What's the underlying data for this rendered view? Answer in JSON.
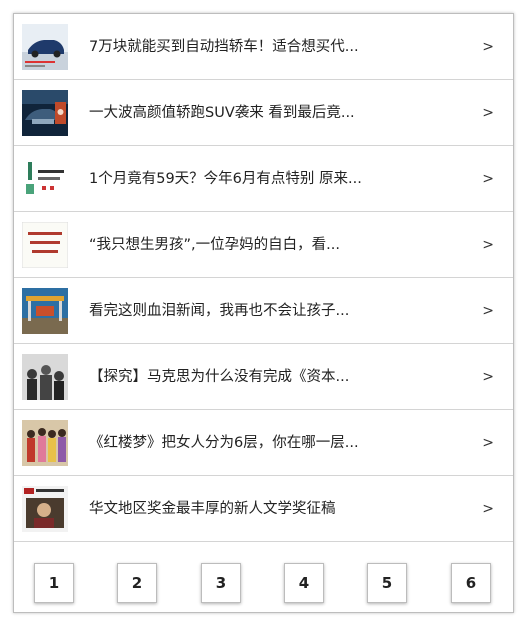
{
  "articles": [
    {
      "title": "7万块就能买到自动挡轿车！适合想买代...",
      "arrow": ">",
      "thumb_icon": "car-photo-icon",
      "thumb_colors": [
        "#e8eef4",
        "#1f3a6b"
      ]
    },
    {
      "title": "一大波高颜值轿跑SUV袭来 看到最后竟...",
      "arrow": ">",
      "thumb_icon": "suv-photo-icon",
      "thumb_colors": [
        "#10243a",
        "#c04a2a"
      ]
    },
    {
      "title": "1个月竟有59天？今年6月有点特别 原来...",
      "arrow": ">",
      "thumb_icon": "calendar-graphic-icon",
      "thumb_colors": [
        "#ffffff",
        "#2e7d5b"
      ]
    },
    {
      "title": "“我只想生男孩”,一位孕妈的自白，看...",
      "arrow": ">",
      "thumb_icon": "text-graphic-icon",
      "thumb_colors": [
        "#fbfbf6",
        "#b03a2e"
      ]
    },
    {
      "title": "看完这则血泪新闻，我再也不会让孩子...",
      "arrow": ">",
      "thumb_icon": "playground-photo-icon",
      "thumb_colors": [
        "#2d6fa3",
        "#e0a330"
      ]
    },
    {
      "title": "【探究】马克思为什么没有完成《资本...",
      "arrow": ">",
      "thumb_icon": "crowd-photo-icon",
      "thumb_colors": [
        "#d9d9d9",
        "#3a3a3a"
      ]
    },
    {
      "title": "《红楼梦》把女人分为6层，你在哪一层...",
      "arrow": ">",
      "thumb_icon": "drama-photo-icon",
      "thumb_colors": [
        "#d8c7a8",
        "#c0392b"
      ]
    },
    {
      "title": "华文地区奖金最丰厚的新人文学奖征稿",
      "arrow": ">",
      "thumb_icon": "magazine-cover-icon",
      "thumb_colors": [
        "#f2f2f2",
        "#b22222"
      ]
    }
  ],
  "pagination": {
    "pages": [
      "1",
      "2",
      "3",
      "4",
      "5",
      "6"
    ]
  }
}
